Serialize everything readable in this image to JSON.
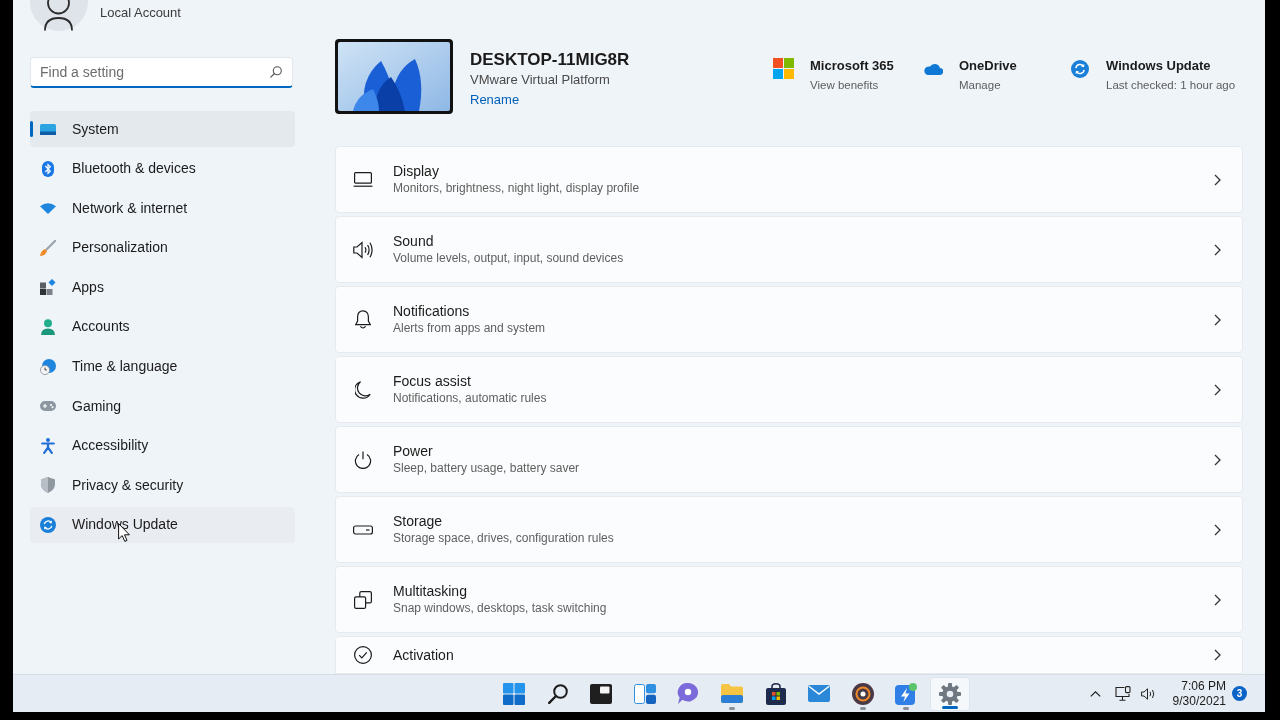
{
  "sidebar": {
    "account": {
      "type": "Local Account"
    },
    "search": {
      "placeholder": "Find a setting",
      "focused": true
    },
    "items": [
      {
        "kind": "system",
        "label": "System",
        "selected": true,
        "hovered": false
      },
      {
        "kind": "bluetooth",
        "label": "Bluetooth & devices",
        "selected": false,
        "hovered": false
      },
      {
        "kind": "network",
        "label": "Network & internet",
        "selected": false,
        "hovered": false
      },
      {
        "kind": "personalization",
        "label": "Personalization",
        "selected": false,
        "hovered": false
      },
      {
        "kind": "apps",
        "label": "Apps",
        "selected": false,
        "hovered": false
      },
      {
        "kind": "accounts",
        "label": "Accounts",
        "selected": false,
        "hovered": false
      },
      {
        "kind": "time",
        "label": "Time & language",
        "selected": false,
        "hovered": false
      },
      {
        "kind": "gaming",
        "label": "Gaming",
        "selected": false,
        "hovered": false
      },
      {
        "kind": "accessibility",
        "label": "Accessibility",
        "selected": false,
        "hovered": false
      },
      {
        "kind": "privacy",
        "label": "Privacy & security",
        "selected": false,
        "hovered": false
      },
      {
        "kind": "update",
        "label": "Windows Update",
        "selected": false,
        "hovered": true
      }
    ]
  },
  "device": {
    "name": "DESKTOP-11MIG8R",
    "model": "VMware Virtual Platform",
    "rename": "Rename"
  },
  "quick_links": [
    {
      "kind": "microsoft365",
      "title": "Microsoft 365",
      "subtitle": "View benefits"
    },
    {
      "kind": "onedrive",
      "title": "OneDrive",
      "subtitle": "Manage"
    },
    {
      "kind": "update",
      "title": "Windows Update",
      "subtitle": "Last checked: 1 hour ago"
    }
  ],
  "cards": [
    {
      "kind": "display",
      "title": "Display",
      "subtitle": "Monitors, brightness, night light, display profile"
    },
    {
      "kind": "sound",
      "title": "Sound",
      "subtitle": "Volume levels, output, input, sound devices"
    },
    {
      "kind": "notifications",
      "title": "Notifications",
      "subtitle": "Alerts from apps and system"
    },
    {
      "kind": "focus_assist",
      "title": "Focus assist",
      "subtitle": "Notifications, automatic rules"
    },
    {
      "kind": "power",
      "title": "Power",
      "subtitle": "Sleep, battery usage, battery saver"
    },
    {
      "kind": "storage",
      "title": "Storage",
      "subtitle": "Storage space, drives, configuration rules"
    },
    {
      "kind": "multitasking",
      "title": "Multitasking",
      "subtitle": "Snap windows, desktops, task switching"
    },
    {
      "kind": "activation",
      "title": "Activation"
    }
  ],
  "taskbar": {
    "apps": [
      {
        "kind": "start",
        "running": false,
        "active": false
      },
      {
        "kind": "search",
        "running": false,
        "active": false
      },
      {
        "kind": "dark_window",
        "running": false,
        "active": false
      },
      {
        "kind": "widgets",
        "running": false,
        "active": false
      },
      {
        "kind": "chat",
        "running": false,
        "active": false
      },
      {
        "kind": "explorer",
        "running": true,
        "active": false
      },
      {
        "kind": "store",
        "running": false,
        "active": false
      },
      {
        "kind": "mail",
        "running": false,
        "active": false
      },
      {
        "kind": "round_app",
        "running": true,
        "active": false
      },
      {
        "kind": "lightning_app",
        "running": true,
        "active": false
      },
      {
        "kind": "settings",
        "running": true,
        "active": true
      }
    ],
    "tray": {
      "time": "7:06 PM",
      "date": "9/30/2021",
      "notifications": "3"
    }
  }
}
